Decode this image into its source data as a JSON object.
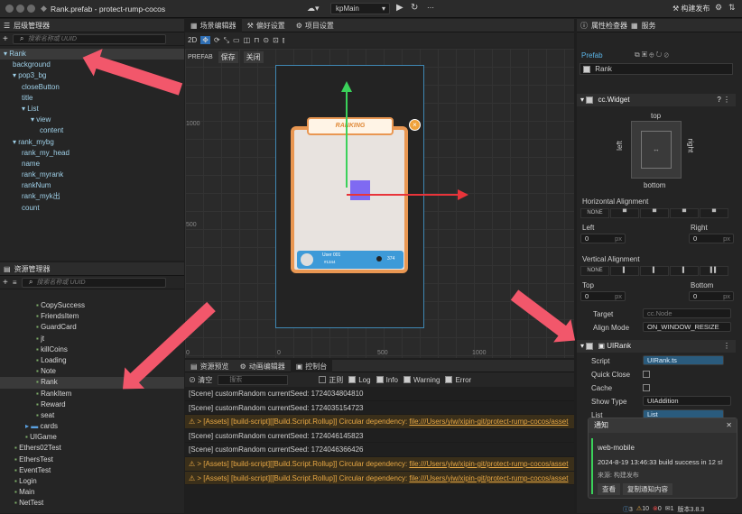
{
  "window": {
    "title": "Rank.prefab - protect-rump-cocos",
    "scene_label": "kpMain",
    "publish_button": "构建发布"
  },
  "hierarchy": {
    "title": "层级管理器",
    "search_placeholder": "搜索名称或 UUID",
    "nodes": [
      {
        "label": "▾ Rank",
        "depth": 0,
        "selected": true
      },
      {
        "label": "background",
        "depth": 1
      },
      {
        "label": "▾ pop3_bg",
        "depth": 1
      },
      {
        "label": "closeButton",
        "depth": 2
      },
      {
        "label": "title",
        "depth": 2
      },
      {
        "label": "▾ List",
        "depth": 2
      },
      {
        "label": "▾ view",
        "depth": 3
      },
      {
        "label": "content",
        "depth": 4
      },
      {
        "label": "▾ rank_mybg",
        "depth": 1
      },
      {
        "label": "rank_my_head",
        "depth": 2
      },
      {
        "label": "name",
        "depth": 2
      },
      {
        "label": "rank_myrank",
        "depth": 2
      },
      {
        "label": "rankNum",
        "depth": 2
      },
      {
        "label": "rank_myk出",
        "depth": 2
      },
      {
        "label": "count",
        "depth": 2
      }
    ]
  },
  "assets": {
    "title": "资源管理器",
    "search_placeholder": "搜索名称或 UUID",
    "items": [
      {
        "label": "CopySuccess",
        "depth": 3
      },
      {
        "label": "FriendsItem",
        "depth": 3
      },
      {
        "label": "GuardCard",
        "depth": 3
      },
      {
        "label": "jt",
        "depth": 3
      },
      {
        "label": "killCoins",
        "depth": 3
      },
      {
        "label": "Loading",
        "depth": 3
      },
      {
        "label": "Note",
        "depth": 3
      },
      {
        "label": "Rank",
        "depth": 3,
        "selected": true
      },
      {
        "label": "RankItem",
        "depth": 3
      },
      {
        "label": "Reward",
        "depth": 3
      },
      {
        "label": "seat",
        "depth": 3
      },
      {
        "label": "cards",
        "depth": 2
      },
      {
        "label": "UIGame",
        "depth": 2
      },
      {
        "label": "Ethers02Test",
        "depth": 1
      },
      {
        "label": "EthersTest",
        "depth": 1
      },
      {
        "label": "EventTest",
        "depth": 1
      },
      {
        "label": "Login",
        "depth": 1
      },
      {
        "label": "Main",
        "depth": 1
      },
      {
        "label": "NetTest",
        "depth": 1
      }
    ]
  },
  "scene_editor": {
    "tabs": [
      "场景编辑器",
      "偏好设置",
      "项目设置"
    ],
    "prefab_label": "PREFAB",
    "save": "保存",
    "close": "关闭",
    "ruler_left": [
      "1000",
      "500",
      "0"
    ],
    "ruler_bottom": [
      "0",
      "500",
      "1000"
    ],
    "ranking_title": "RANKING",
    "user_name": "User 001",
    "user_id": "#1344",
    "user_score": "374",
    "mode_2d": "2D"
  },
  "console": {
    "tabs": [
      "资源预览",
      "动画编辑器",
      "控制台"
    ],
    "clear": "清空",
    "search_placeholder": "搜索",
    "regex": "正则",
    "filters": [
      "Log",
      "Info",
      "Warning",
      "Error"
    ],
    "lines": [
      {
        "type": "scene",
        "text": "[Scene] customRandom currentSeed: 1724034804810"
      },
      {
        "type": "scene",
        "text": "[Scene] customRandom currentSeed: 1724035154723"
      },
      {
        "type": "warn",
        "prefix": "[Assets] [build-script][[Build.Script.Rollup]] Circular dependency: ",
        "link": "file:///Users/yiw/xipin-git/protect-rump-cocos/asset"
      },
      {
        "type": "scene",
        "text": "[Scene] customRandom currentSeed: 1724046145823"
      },
      {
        "type": "scene",
        "text": "[Scene] customRandom currentSeed: 1724046366426"
      },
      {
        "type": "warn",
        "prefix": "[Assets] [build-script][[Build.Script.Rollup]] Circular dependency: ",
        "link": "file:///Users/yiw/xipin-git/protect-rump-cocos/asset"
      },
      {
        "type": "warn",
        "prefix": "[Assets] [build-script][[Build.Script.Rollup]] Circular dependency: ",
        "link": "file:///Users/yiw/xipin-git/protect-rump-cocos/asset"
      }
    ]
  },
  "inspector": {
    "tabs": [
      "属性检查器",
      "服务"
    ],
    "prefab_label": "Prefab",
    "node_name": "Rank",
    "widget": {
      "title": "cc.Widget",
      "top": "top",
      "bottom": "bottom",
      "left": "left",
      "right": "right",
      "h_align_label": "Horizontal Alignment",
      "none": "NONE",
      "left_label": "Left",
      "right_label": "Right",
      "left_value": "0",
      "right_value": "0",
      "px": "px",
      "v_align_label": "Vertical Alignment",
      "top_label": "Top",
      "bottom_label": "Bottom",
      "top_value": "0",
      "bottom_value": "0",
      "target_label": "Target",
      "target_value": "cc.Node",
      "align_mode_label": "Align Mode",
      "align_mode_value": "ON_WINDOW_RESIZE"
    },
    "uirank": {
      "title": "UIRank",
      "script_label": "Script",
      "script_value": "UIRank.ts",
      "quick_close": "Quick Close",
      "cache": "Cache",
      "show_type_label": "Show Type",
      "show_type_value": "UIAddition",
      "list_label": "List",
      "list_value": "List"
    }
  },
  "notification": {
    "header": "通知",
    "platform": "web-mobile",
    "message": "2024-8-19 13:46:33 build success in 12 s!",
    "source": "来源: 构建发布",
    "view": "查看",
    "copy": "复制通知内容"
  },
  "statusbar": {
    "count1": "3",
    "count2": "10",
    "count3": "0",
    "count4": "1",
    "version": "版本3.8.3"
  }
}
